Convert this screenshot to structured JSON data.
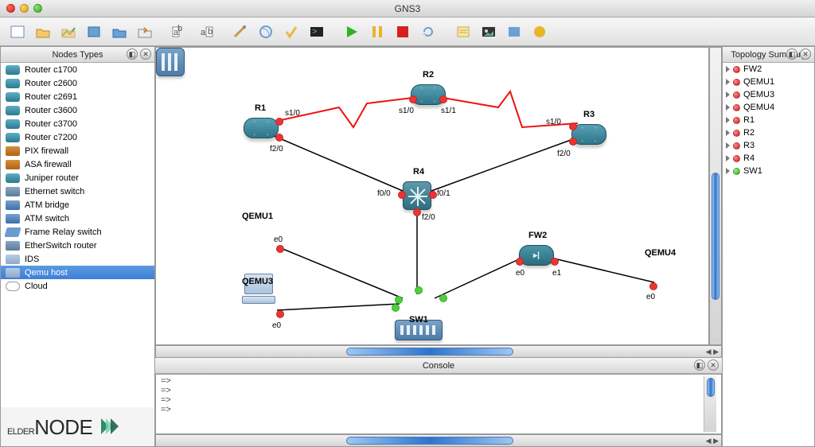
{
  "window": {
    "title": "GNS3"
  },
  "panels": {
    "nodes_title": "Nodes Types",
    "topology_title": "Topology Summary",
    "console_title": "Console"
  },
  "nodes": [
    {
      "label": "Router c1700",
      "icon": "router-i"
    },
    {
      "label": "Router c2600",
      "icon": "router-i"
    },
    {
      "label": "Router c2691",
      "icon": "router-i"
    },
    {
      "label": "Router c3600",
      "icon": "router-i"
    },
    {
      "label": "Router c3700",
      "icon": "router-i"
    },
    {
      "label": "Router c7200",
      "icon": "router-i"
    },
    {
      "label": "PIX firewall",
      "icon": "fw-i"
    },
    {
      "label": "ASA firewall",
      "icon": "fw-i"
    },
    {
      "label": "Juniper router",
      "icon": "router-i"
    },
    {
      "label": "Ethernet switch",
      "icon": "sw-i"
    },
    {
      "label": "ATM bridge",
      "icon": "atm-i"
    },
    {
      "label": "ATM switch",
      "icon": "atm-i"
    },
    {
      "label": "Frame Relay switch",
      "icon": "fr-i"
    },
    {
      "label": "EtherSwitch router",
      "icon": "sw-i"
    },
    {
      "label": "IDS",
      "icon": "host-i"
    },
    {
      "label": "Qemu host",
      "icon": "host-i",
      "selected": true
    },
    {
      "label": "Cloud",
      "icon": "cloud-i"
    }
  ],
  "topology": {
    "devices": {
      "R1": {
        "label": "R1"
      },
      "R2": {
        "label": "R2"
      },
      "R3": {
        "label": "R3"
      },
      "R4": {
        "label": "R4"
      },
      "SW1": {
        "label": "SW1"
      },
      "FW2": {
        "label": "FW2"
      },
      "QEMU1": {
        "label": "QEMU1"
      },
      "QEMU3": {
        "label": "QEMU3"
      },
      "QEMU4": {
        "label": "QEMU4"
      }
    },
    "interface_labels": {
      "r1_s10": "s1/0",
      "r1_f20": "f2/0",
      "r2_s10": "s1/0",
      "r2_s11": "s1/1",
      "r3_s10": "s1/0",
      "r3_f20": "f2/0",
      "r4_f00": "f0/0",
      "r4_f01": "f0/1",
      "r4_f20": "f2/0",
      "q1_e0": "e0",
      "q3_e0": "e0",
      "q4_e0": "e0",
      "fw2_e0": "e0",
      "fw2_e1": "e1"
    }
  },
  "summary": [
    {
      "name": "FW2",
      "status": "red"
    },
    {
      "name": "QEMU1",
      "status": "red"
    },
    {
      "name": "QEMU3",
      "status": "red"
    },
    {
      "name": "QEMU4",
      "status": "red"
    },
    {
      "name": "R1",
      "status": "red"
    },
    {
      "name": "R2",
      "status": "red"
    },
    {
      "name": "R3",
      "status": "red"
    },
    {
      "name": "R4",
      "status": "red"
    },
    {
      "name": "SW1",
      "status": "green"
    }
  ],
  "console": {
    "line1": "=>",
    "line2": "=>",
    "line3": "=>",
    "line4": "=>"
  },
  "watermark": {
    "brand1": "ELDER",
    "brand2": "NODE"
  }
}
